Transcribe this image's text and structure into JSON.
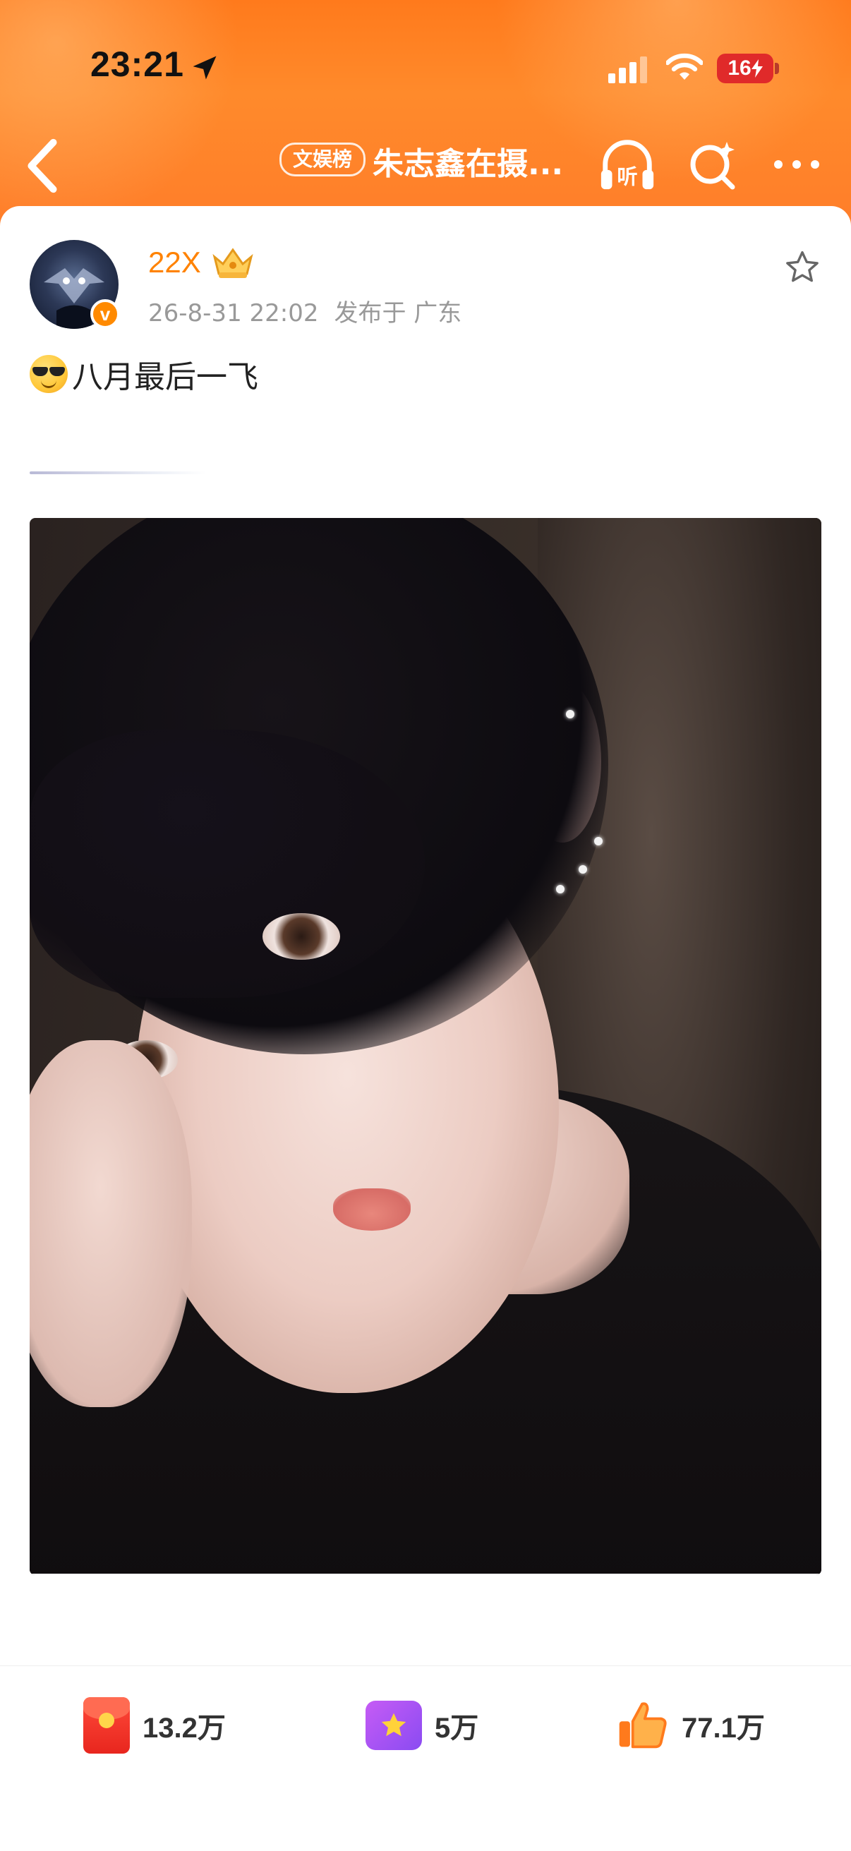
{
  "status_bar": {
    "time": "23:21",
    "battery": "16"
  },
  "nav": {
    "rank_badge": "文娱榜",
    "title": "朱志鑫在摄..."
  },
  "post": {
    "author": "22X",
    "timestamp": "26-8-31 22:02",
    "location": "发布于 广东",
    "text": "八月最后一飞"
  },
  "actions": {
    "gift_count": "13.2万",
    "star_count": "5万",
    "like_count": "77.1万"
  },
  "colors": {
    "header_orange": "#ff7a1c",
    "username_orange": "#ff8200",
    "battery_red": "#e02a2a"
  },
  "icons": [
    "back-icon",
    "location-arrow-icon",
    "signal-icon",
    "wifi-icon",
    "battery-icon",
    "listen-icon",
    "search-icon",
    "more-icon",
    "crown-icon",
    "star-outline-icon",
    "red-packet-icon",
    "star-gift-icon",
    "thumbs-up-icon"
  ]
}
